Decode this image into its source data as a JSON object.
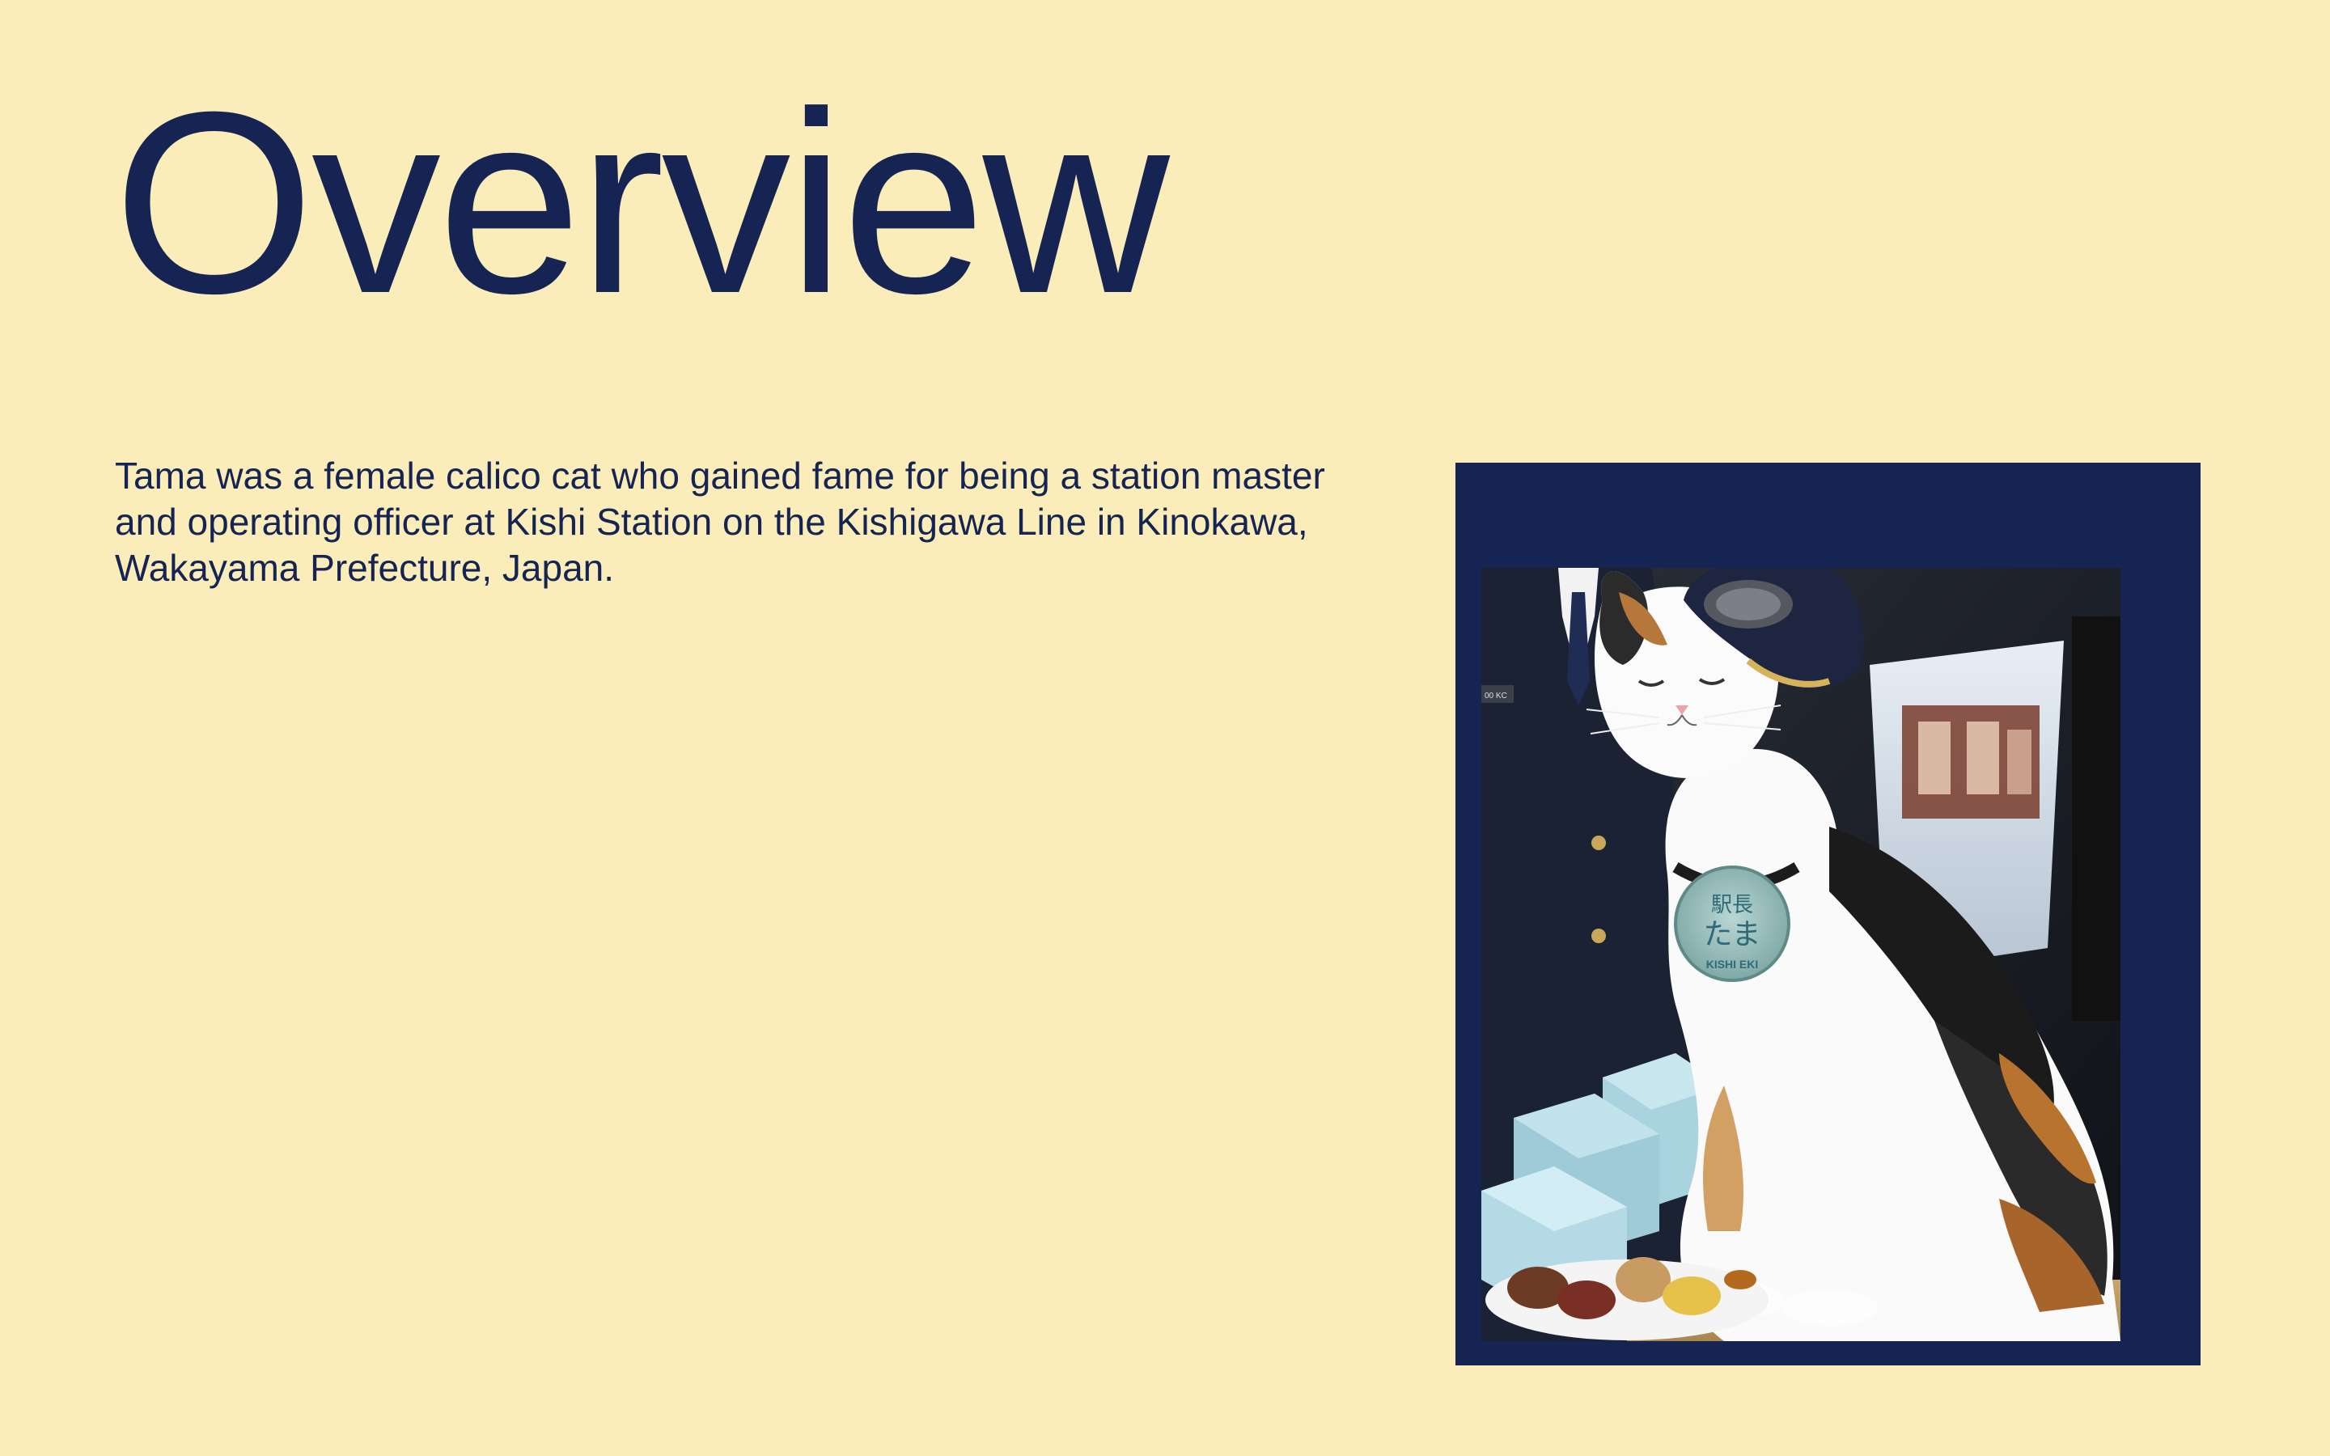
{
  "slide": {
    "title": "Overview",
    "body": "Tama was a female calico cat who gained fame for being a station master and operating officer at Kishi Station on the Kishigawa Line in Kinokawa, Wakayama Prefecture, Japan."
  },
  "photo": {
    "badge_line1": "駅長",
    "badge_line2": "たま",
    "badge_line3": "KISHI EKI",
    "name_tag": "00 KC"
  },
  "colors": {
    "background": "#faedb9",
    "accent": "#152452"
  }
}
